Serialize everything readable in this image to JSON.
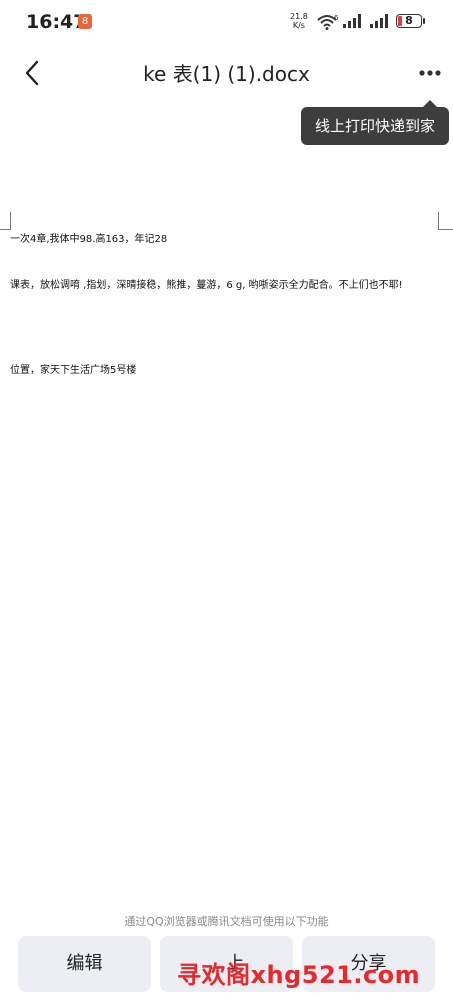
{
  "status_bar": {
    "time": "16:47",
    "notification_badge": "8",
    "net_speed_value": "21.8",
    "net_speed_unit": "K/s",
    "wifi_badge": "6",
    "battery": "8",
    "battery_color": "#e53935"
  },
  "header": {
    "title": "ke 表(1) (1).docx",
    "tooltip": "线上打印快递到家"
  },
  "document": {
    "lines": [
      "一次4章,我体中98.高163，年记28",
      "课表，放松调唷 ,指划，深晴接稳，熊推，蔓游，6 g, 哟哳姿示全力配合。不上们也不耶!",
      "位置，家天下生活广场5号楼"
    ]
  },
  "footer": {
    "hint": "通过QQ浏览器或腾讯文档可使用以下功能",
    "buttons": [
      "编辑",
      "…上",
      "分享"
    ],
    "watermark": "寻欢阁xhg521.com"
  },
  "colors": {
    "tooltip_bg": "#3d3d3d",
    "button_bg": "#eceef3",
    "watermark": "#e8282b"
  }
}
